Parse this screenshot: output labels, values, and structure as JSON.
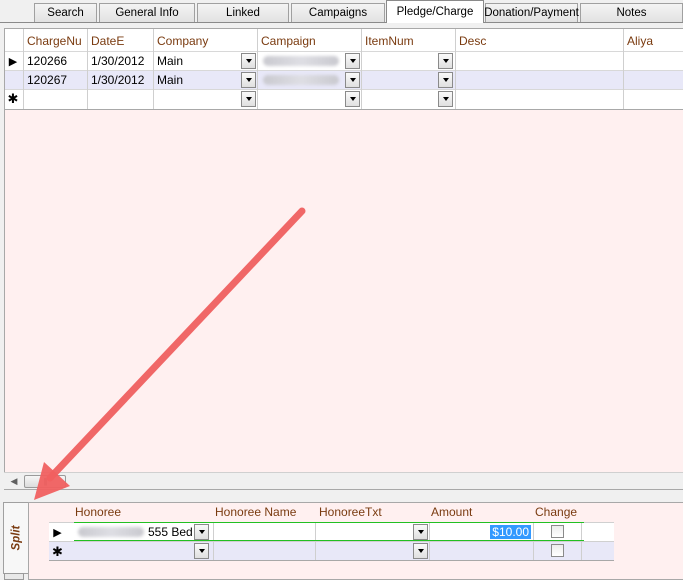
{
  "tabs": [
    {
      "label": "Search",
      "active": false
    },
    {
      "label": "General Info",
      "active": false
    },
    {
      "label": "Linked",
      "active": false
    },
    {
      "label": "Campaigns",
      "active": false
    },
    {
      "label": "Pledge/Charge",
      "active": true
    },
    {
      "label": "Donation/Payment",
      "active": false
    },
    {
      "label": "Notes",
      "active": false
    }
  ],
  "charges": {
    "columns": [
      "ChargeNu",
      "DateE",
      "Company",
      "Campaign",
      "ItemNum",
      "Desc",
      "Aliya"
    ],
    "rows": [
      {
        "charge_num": "120266",
        "date": "1/30/2012",
        "company": "Main",
        "current": true
      },
      {
        "charge_num": "120267",
        "date": "1/30/2012",
        "company": "Main",
        "current": false
      }
    ],
    "new_row_marker": "✱",
    "current_row_marker": "▶"
  },
  "scrollbar": {
    "thumb_grip": "|||"
  },
  "split_tab": {
    "label": "Split"
  },
  "splits": {
    "columns": [
      "Honoree",
      "Honoree Name",
      "HonoreeTxt",
      "Amount",
      "Change"
    ],
    "rows": [
      {
        "honoree_partial": "555 Bed",
        "amount": "$10.00",
        "change": false
      }
    ],
    "new_row_marker": "✱",
    "current_row_marker": "▶"
  },
  "colors": {
    "header_text": "#7a3b10",
    "panel_bg": "#fff0f0",
    "arrow": "#f06060",
    "amount_highlight": "#3399ff"
  }
}
